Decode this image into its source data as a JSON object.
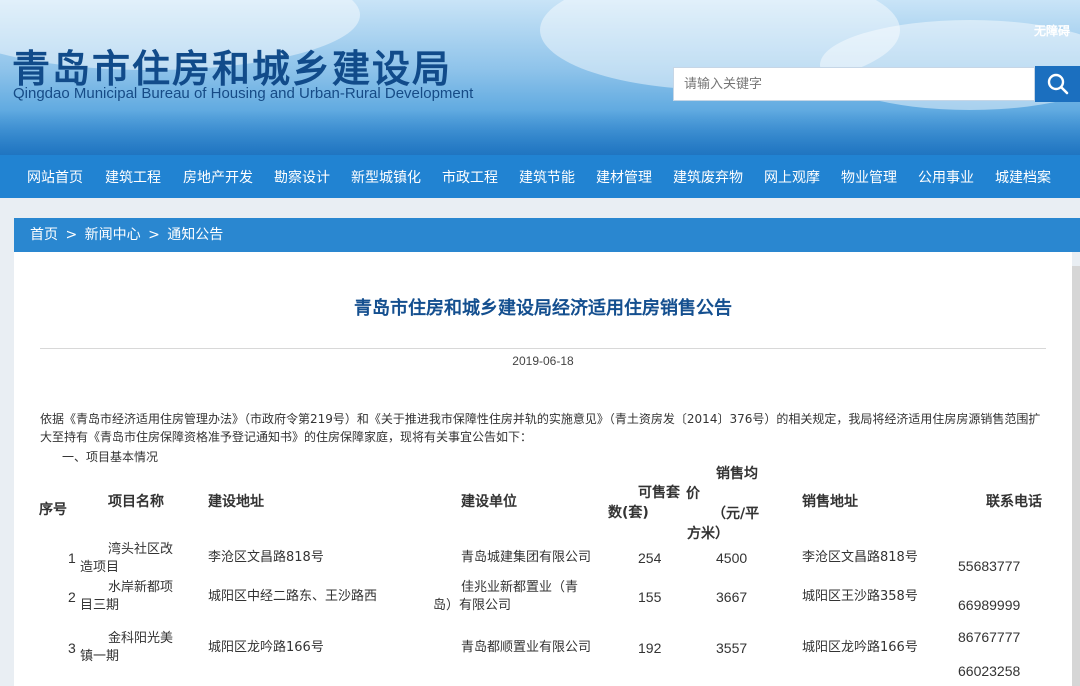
{
  "header": {
    "title": "青岛市住房和城乡建设局",
    "subtitle": "Qingdao Municipal Bureau of Housing and Urban-Rural Development",
    "accessibility": "无障碍",
    "search_placeholder": "请输入关键字",
    "search_icon": "magnifier-icon"
  },
  "nav": {
    "items": [
      "网站首页",
      "建筑工程",
      "房地产开发",
      "勘察设计",
      "新型城镇化",
      "市政工程",
      "建筑节能",
      "建材管理",
      "建筑废弃物",
      "网上观摩",
      "物业管理",
      "公用事业",
      "城建档案"
    ]
  },
  "breadcrumb": {
    "home": "首页",
    "news": "新闻中心",
    "notices": "通知公告",
    "separator": ">"
  },
  "article": {
    "title": "青岛市住房和城乡建设局经济适用住房销售公告",
    "date": "2019-06-18",
    "intro": "依据《青岛市经济适用住房管理办法》（市政府令第219号）和《关于推进我市保障性住房并轨的实施意见》（青土资房发〔2014〕376号）的相关规定，我局将经济适用住房房源销售范围扩大至持有《青岛市住房保障资格准予登记通知书》的住房保障家庭，现将有关事宜公告如下：",
    "section1": "一、项目基本情况"
  },
  "table": {
    "headers": {
      "no": "序号",
      "name": "项目名称",
      "address": "建设地址",
      "developer": "建设单位",
      "units_l1": "可售套",
      "units_l2": "数(套)",
      "price_l1": "销售均",
      "price_l2": "价",
      "price_l3": "（元/平",
      "price_l4": "方米）",
      "sales_addr": "销售地址",
      "phone": "联系电话"
    },
    "rows": [
      {
        "no": "1",
        "name_l1": "湾头社区改",
        "name_l2": "造项目",
        "address": "李沧区文昌路818号",
        "developer_l1": "青岛城建集团有限公司",
        "developer_l2": "",
        "units": "254",
        "price": "4500",
        "sales_addr": "李沧区文昌路818号",
        "phone_l1": "55683777",
        "phone_l2": ""
      },
      {
        "no": "2",
        "name_l1": "水岸新都项",
        "name_l2": "目三期",
        "address": "城阳区中经二路东、王沙路西",
        "developer_l1": "佳兆业新都置业（青",
        "developer_l2": "岛）有限公司",
        "units": "155",
        "price": "3667",
        "sales_addr": "城阳区王沙路358号",
        "phone_l1": "66989999",
        "phone_l2": ""
      },
      {
        "no": "3",
        "name_l1": "金科阳光美",
        "name_l2": "镇一期",
        "address": "城阳区龙吟路166号",
        "developer_l1": "青岛都顺置业有限公司",
        "developer_l2": "",
        "units": "192",
        "price": "3557",
        "sales_addr": "城阳区龙吟路166号",
        "phone_l1": "86767777",
        "phone_l2": "66023258"
      }
    ]
  }
}
